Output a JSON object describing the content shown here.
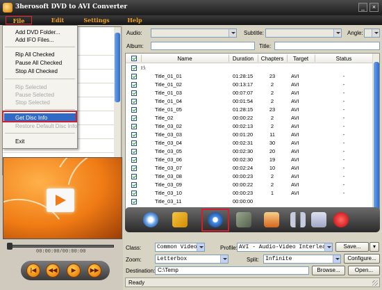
{
  "window": {
    "title": "3herosoft DVD to AVI Converter",
    "minimize_glyph": "_",
    "close_glyph": "×"
  },
  "menubar": {
    "items": [
      {
        "label": "File"
      },
      {
        "label": "Edit"
      },
      {
        "label": "Settings"
      },
      {
        "label": "Help"
      }
    ]
  },
  "file_menu": {
    "add_dvd_folder": "Add DVD Folder...",
    "add_ifo_files": "Add IFO Files...",
    "rip_all_checked": "Rip All Checked",
    "pause_all_checked": "Pause All Checked",
    "stop_all_checked": "Stop All Checked",
    "rip_selected": "Rip Selected",
    "pause_selected": "Pause Selected",
    "stop_selected": "Stop Selected",
    "get_disc_info": "Get Disc Info",
    "restore_default": "Restore Default Disc Info",
    "exit": "Exit"
  },
  "player": {
    "timecode": "00:00:00/00:00:00",
    "buttons": [
      "|◀",
      "◀◀",
      "▶",
      "▶▶"
    ]
  },
  "top_fields": {
    "audio_label": "Audio:",
    "audio_value": "",
    "subtitle_label": "Subtitle:",
    "subtitle_value": "",
    "angle_label": "Angle:",
    "angle_value": "",
    "album_label": "Album:",
    "album_value": "",
    "title_label": "Title:",
    "title_value": ""
  },
  "table": {
    "columns": [
      "Name",
      "Duration",
      "Chapters",
      "Target",
      "Status"
    ],
    "root": "I:\\",
    "rows": [
      {
        "name": "Title_01_01",
        "duration": "01:28:15",
        "chapters": "23",
        "target": "AVI",
        "status": "-"
      },
      {
        "name": "Title_01_02",
        "duration": "00:13:17",
        "chapters": "2",
        "target": "AVI",
        "status": "-"
      },
      {
        "name": "Title_01_03",
        "duration": "00:07:07",
        "chapters": "2",
        "target": "AVI",
        "status": "-"
      },
      {
        "name": "Title_01_04",
        "duration": "00:01:54",
        "chapters": "2",
        "target": "AVI",
        "status": "-"
      },
      {
        "name": "Title_01_05",
        "duration": "01:28:15",
        "chapters": "23",
        "target": "AVI",
        "status": "-"
      },
      {
        "name": "Title_02",
        "duration": "00:00:22",
        "chapters": "2",
        "target": "AVI",
        "status": "-"
      },
      {
        "name": "Title_03_02",
        "duration": "00:02:13",
        "chapters": "2",
        "target": "AVI",
        "status": "-"
      },
      {
        "name": "Title_03_03",
        "duration": "00:01:20",
        "chapters": "11",
        "target": "AVI",
        "status": "-"
      },
      {
        "name": "Title_03_04",
        "duration": "00:02:31",
        "chapters": "30",
        "target": "AVI",
        "status": "-"
      },
      {
        "name": "Title_03_05",
        "duration": "00:02:30",
        "chapters": "20",
        "target": "AVI",
        "status": "-"
      },
      {
        "name": "Title_03_06",
        "duration": "00:02:30",
        "chapters": "19",
        "target": "AVI",
        "status": "-"
      },
      {
        "name": "Title_03_07",
        "duration": "00:02:24",
        "chapters": "10",
        "target": "AVI",
        "status": "-"
      },
      {
        "name": "Title_03_08",
        "duration": "00:00:23",
        "chapters": "2",
        "target": "AVI",
        "status": "-"
      },
      {
        "name": "Title_03_09",
        "duration": "00:00:22",
        "chapters": "2",
        "target": "AVI",
        "status": "-"
      },
      {
        "name": "Title_03_10",
        "duration": "00:00:23",
        "chapters": "1",
        "target": "AVI",
        "status": "-"
      },
      {
        "name": "Title_03_11",
        "duration": "00:00:00",
        "chapters": "",
        "target": "",
        "status": ""
      }
    ]
  },
  "toolbar": {
    "icons": [
      "dvd-icon",
      "output-folder-icon",
      "disc-info-icon",
      "clip-icon",
      "effect-icon",
      "pause-icon",
      "stop-icon",
      "record-icon"
    ]
  },
  "bottom": {
    "class_label": "Class:",
    "class_value": "Common Video",
    "profile_label": "Profile:",
    "profile_value": "AVI - Audio-Video Interleaved",
    "save_button": "Save...",
    "zoom_label": "Zoom:",
    "zoom_value": "Letterbox",
    "split_label": "Split:",
    "split_value": "Infinite",
    "configure_button": "Configure...",
    "destination_label": "Destination:",
    "destination_value": "C:\\Temp",
    "browse_button": "Browse...",
    "open_button": "Open..."
  },
  "status": {
    "text": "Ready"
  },
  "colors": {
    "menu_text": "#f0a020",
    "highlight_red": "#d02030",
    "selection_blue": "#316ac5"
  }
}
